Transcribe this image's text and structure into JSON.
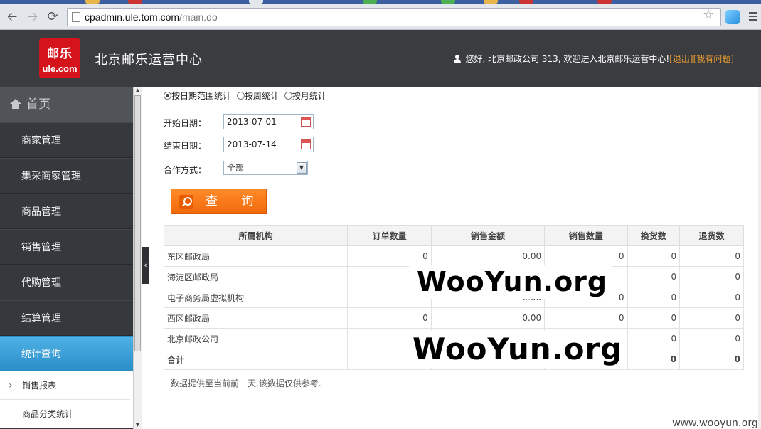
{
  "browser": {
    "url_host": "cpadmin.ule.tom.com",
    "url_path": "/main.do",
    "icons": [
      "back-icon",
      "forward-icon",
      "reload-icon",
      "star-icon",
      "menu-icon"
    ],
    "nav": {
      "back": "🡠",
      "forward": "🡢",
      "reload": "⟳",
      "star": "☆"
    }
  },
  "header": {
    "logo_line1": "邮乐",
    "logo_line2": "ule.com",
    "title": "北京邮乐运营中心",
    "welcome": "您好, 北京邮政公司  313, 欢迎进入北京邮乐运营中心!",
    "logout": "[退出]",
    "help": "[我有问题]"
  },
  "sidebar": {
    "home": "首页",
    "items": [
      {
        "label": "商家管理",
        "active": false
      },
      {
        "label": "集采商家管理",
        "active": false
      },
      {
        "label": "商品管理",
        "active": false
      },
      {
        "label": "销售管理",
        "active": false
      },
      {
        "label": "代购管理",
        "active": false
      },
      {
        "label": "结算管理",
        "active": false
      },
      {
        "label": "统计查询",
        "active": true
      }
    ],
    "sub_items": [
      {
        "label": "销售报表"
      },
      {
        "label": "商品分类统计"
      }
    ],
    "collapse_glyph": "‹"
  },
  "filters": {
    "modes": [
      {
        "label": "按日期范围统计",
        "selected": true
      },
      {
        "label": "按周统计",
        "selected": false
      },
      {
        "label": "按月统计",
        "selected": false
      }
    ],
    "start_label": "开始日期：",
    "start_value": "2013-07-01",
    "end_label": "结束日期：",
    "end_value": "2013-07-14",
    "coop_label": "合作方式：",
    "coop_value": "全部",
    "query_label": "查 询"
  },
  "table": {
    "headers": [
      "所属机构",
      "订单数量",
      "销售金额",
      "销售数量",
      "换货数",
      "退货数"
    ],
    "rows": [
      [
        "东区邮政局",
        "0",
        "0.00",
        "0",
        "0",
        "0"
      ],
      [
        "海淀区邮政局",
        "",
        "",
        "",
        "0",
        "0"
      ],
      [
        "电子商务局虚拟机构",
        "",
        "0.00",
        "0",
        "0",
        "0"
      ],
      [
        "西区邮政局",
        "0",
        "0.00",
        "0",
        "0",
        "0"
      ],
      [
        "北京邮政公司",
        "",
        "",
        "",
        "0",
        "0"
      ],
      [
        "合计",
        "",
        "",
        "",
        "0",
        "0"
      ]
    ]
  },
  "note": "数据提供至当前前一天,该数据仅供参考.",
  "watermarks": {
    "overlay1": "WooYun.org",
    "overlay2": "WooYun.org",
    "site": "www.wooyun.org"
  }
}
